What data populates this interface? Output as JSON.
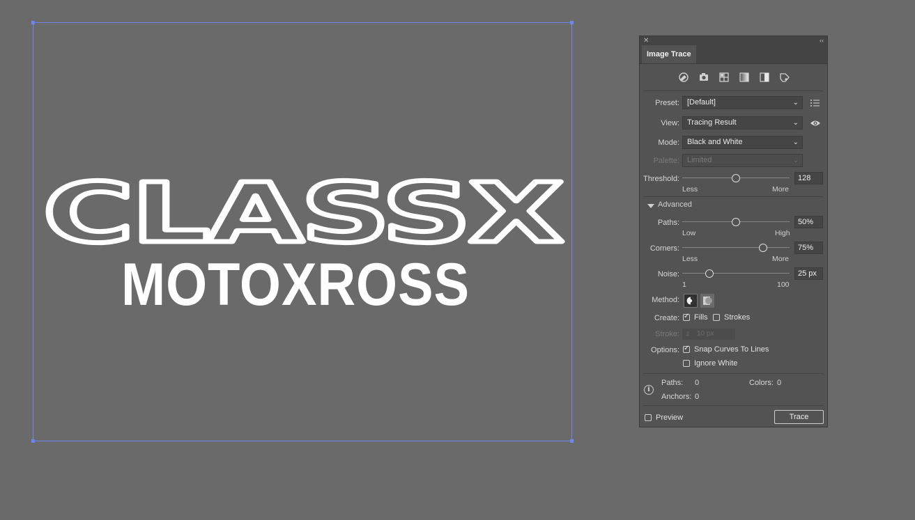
{
  "artwork": {
    "line1": "CLASSX",
    "line2": "MOTOXROSS"
  },
  "panel": {
    "tab_title": "Image Trace",
    "close_glyph": "✕",
    "collapse_glyph": "‹‹",
    "top_icons": [
      "auto-color-icon",
      "high-color-icon",
      "low-color-icon",
      "grayscale-icon",
      "black-and-white-icon",
      "outline-icon"
    ],
    "preset": {
      "label": "Preset:",
      "value": "[Default]"
    },
    "view": {
      "label": "View:",
      "value": "Tracing Result"
    },
    "mode": {
      "label": "Mode:",
      "value": "Black and White"
    },
    "palette": {
      "label": "Palette:",
      "value": "Limited"
    },
    "threshold": {
      "label": "Threshold:",
      "value": "128",
      "min_label": "Less",
      "max_label": "More",
      "level": 0.5
    },
    "advanced": {
      "label": "Advanced"
    },
    "paths": {
      "label": "Paths:",
      "value": "50%",
      "min_label": "Low",
      "max_label": "High",
      "level": 0.5
    },
    "corners": {
      "label": "Corners:",
      "value": "75%",
      "min_label": "Less",
      "max_label": "More",
      "level": 0.75
    },
    "noise": {
      "label": "Noise:",
      "value": "25 px",
      "min_label": "1",
      "max_label": "100",
      "level": 0.25
    },
    "method": {
      "label": "Method:"
    },
    "create": {
      "label": "Create:",
      "fills": "Fills",
      "strokes": "Strokes",
      "fills_checked": true,
      "strokes_checked": false
    },
    "stroke": {
      "label": "Stroke:",
      "value": "10 px"
    },
    "options": {
      "label": "Options:",
      "snap": "Snap Curves To Lines",
      "ignore_white": "Ignore White",
      "snap_checked": true,
      "ignore_checked": false
    },
    "stats": {
      "paths_label": "Paths:",
      "paths_value": "0",
      "colors_label": "Colors:",
      "colors_value": "0",
      "anchors_label": "Anchors:",
      "anchors_value": "0"
    },
    "preview": {
      "label": "Preview",
      "checked": false
    },
    "trace_button": "Trace"
  },
  "colors": {
    "canvas": "#6a6a6a",
    "artboard_border": "#6f86f2",
    "panel_bg": "#535353"
  }
}
